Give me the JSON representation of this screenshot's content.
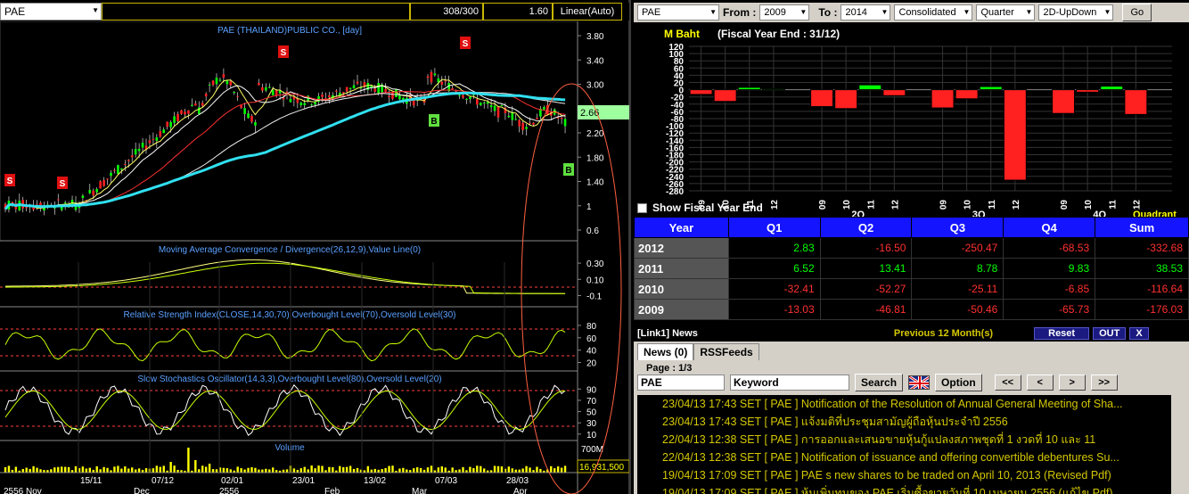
{
  "toolbar": {
    "symbol": "PAE",
    "blank": "",
    "counter": "308/300",
    "scale": "1.60",
    "mode": "Linear(Auto)"
  },
  "chart": {
    "title": "PAE (THAILAND)PUBLIC CO., [day]",
    "price_label": "2.66",
    "volume_label": "16,931,500",
    "price_ticks": [
      "3.80",
      "3.40",
      "3.00",
      "2.60",
      "2.20",
      "1.80",
      "1.40",
      "1",
      "0.6"
    ],
    "macd_title": "Moving Average Convergence / Divergence(26,12,9),Value Line(0)",
    "macd_ticks": [
      "0.30",
      "0.10",
      "-0.1"
    ],
    "rsi_title": "Relative Strength Index(CLOSE,14,30,70),Overbought Level(70),Oversold Level(30)",
    "rsi_ticks": [
      "80",
      "60",
      "40",
      "20"
    ],
    "sto_title": "Slow Stochastics Oscillator(14,3,3),Overbought Level(80),Oversold Level(20)",
    "sto_ticks": [
      "90",
      "70",
      "50",
      "30",
      "10"
    ],
    "vol_title": "Volume",
    "vol_tick": "700M",
    "date_ticks": [
      "15/11",
      "07/12",
      "02/01",
      "23/01",
      "13/02",
      "07/03",
      "28/03"
    ],
    "bottom_labels": [
      "2556 Nov",
      "Dec",
      "2556",
      "Feb",
      "Mar",
      "Apr"
    ],
    "signals": [
      {
        "type": "S",
        "x": 11,
        "y": 178
      },
      {
        "type": "S",
        "x": 70,
        "y": 181
      },
      {
        "type": "S",
        "x": 318,
        "y": 34
      },
      {
        "type": "S",
        "x": 522,
        "y": 24
      },
      {
        "type": "B",
        "x": 487,
        "y": 111
      },
      {
        "type": "B",
        "x": 638,
        "y": 166
      }
    ]
  },
  "right_toolbar": {
    "symbol": "PAE",
    "from_label": "From :",
    "from_value": "2009",
    "to_label": "To :",
    "to_value": "2014",
    "consolidated": "Consolidated",
    "period": "Quarter",
    "view": "2D-UpDown",
    "go": "Go"
  },
  "bar_chart": {
    "unit_label": "M Baht",
    "fy_label": "(Fiscal Year End : 31/12)",
    "y_ticks": [
      "120",
      "100",
      "80",
      "60",
      "40",
      "20",
      "0",
      "-20",
      "-40",
      "-60",
      "-80",
      "-100",
      "-120",
      "-140",
      "-160",
      "-180",
      "-200",
      "-220",
      "-240",
      "-260",
      "-280"
    ],
    "x_labels": [
      "09",
      "10",
      "11",
      "12",
      "09",
      "10",
      "11",
      "12",
      "09",
      "10",
      "11",
      "12",
      "09",
      "10",
      "11",
      "12"
    ],
    "quarter_labels": [
      "2Q",
      "3Q",
      "4Q"
    ],
    "quadrant_label": "Quadrant"
  },
  "chart_data": {
    "type": "bar",
    "title": "",
    "ylabel": "M Baht",
    "ylim": [
      -280,
      120
    ],
    "categories": [
      "Q1 2009",
      "Q1 2010",
      "Q1 2011",
      "Q1 2012",
      "Q2 2009",
      "Q2 2010",
      "Q2 2011",
      "Q2 2012",
      "Q3 2009",
      "Q3 2010",
      "Q3 2011",
      "Q3 2012",
      "Q4 2009",
      "Q4 2010",
      "Q4 2011",
      "Q4 2012"
    ],
    "values": [
      -13.03,
      -32.41,
      6.52,
      2.83,
      -46.81,
      -52.27,
      13.41,
      -16.5,
      -50.46,
      -25.11,
      8.78,
      -250.47,
      -65.73,
      -6.85,
      9.83,
      -68.53
    ]
  },
  "show_fy_label": "Show Fiscal Year End",
  "table": {
    "headers": [
      "Year",
      "Q1",
      "Q2",
      "Q3",
      "Q4",
      "Sum"
    ],
    "rows": [
      {
        "year": "2012",
        "q1": "2.83",
        "q2": "-16.50",
        "q3": "-250.47",
        "q4": "-68.53",
        "sum": "-332.68"
      },
      {
        "year": "2011",
        "q1": "6.52",
        "q2": "13.41",
        "q3": "8.78",
        "q4": "9.83",
        "sum": "38.53"
      },
      {
        "year": "2010",
        "q1": "-32.41",
        "q2": "-52.27",
        "q3": "-25.11",
        "q4": "-6.85",
        "sum": "-116.64"
      },
      {
        "year": "2009",
        "q1": "-13.03",
        "q2": "-46.81",
        "q3": "-50.46",
        "q4": "-65.73",
        "sum": "-176.03"
      }
    ]
  },
  "news": {
    "header": "[Link1] News",
    "previous": "Previous 12 Month(s)",
    "reset": "Reset",
    "out": "OUT",
    "close": "X",
    "tab_news": "News (0)",
    "tab_rss": "RSSFeeds",
    "page": "Page : 1/3",
    "symbol": "PAE",
    "keyword": "Keyword",
    "search": "Search",
    "option": "Option",
    "nav_first": "<<",
    "nav_prev": "<",
    "nav_next": ">",
    "nav_last": ">>",
    "items": [
      "23/04/13 17:43  SET  [ PAE ]  Notification of the Resolution of Annual General Meeting of Sha...",
      "23/04/13 17:43  SET  [ PAE ]  แจ้งมติที่ประชุมสามัญผู้ถือหุ้นประจำปี 2556",
      "22/04/13 12:38  SET  [ PAE ]  การออกและเสนอขายหุ้นกู้แปลงสภาพชุดที่ 1 งวดที่ 10 และ 11",
      "22/04/13 12:38  SET  [ PAE ]  Notification of  issuance and offering convertible debentures Su...",
      "19/04/13 17:09  SET  [ PAE ]  PAE s new shares to be traded on April 10, 2013 (Revised Pdf)",
      "19/04/13 17:09  SET  [ PAE ]  หุ้นเพิ่มทุนของ PAE เริ่มซื้อขายวันที่ 10 เมษายน 2556 (แก้ไข Pdf)"
    ]
  },
  "colors": {
    "up": "#00ff00",
    "down": "#ff2020",
    "yellow": "#d4c800",
    "cyan": "#30e0f0",
    "header_blue": "#1414ff"
  }
}
